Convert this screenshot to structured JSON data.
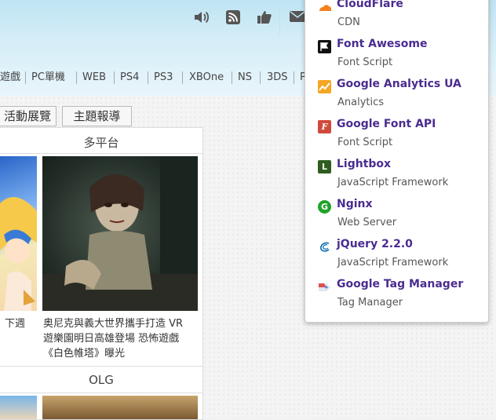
{
  "nav": {
    "items": [
      "遊戲",
      "PC單機",
      "WEB",
      "PS4",
      "PS3",
      "XBOne",
      "NS",
      "3DS",
      "P"
    ]
  },
  "tabs": [
    "活動展覽",
    "主題報導"
  ],
  "panel": {
    "section1_title": "多平台",
    "left_caption": "下週",
    "right_caption_lines": [
      "奥尼克與義大世界攜手打造 VR",
      "遊樂園明日高雄登場 恐怖遊戲",
      "《白色帷塔》曝光"
    ],
    "section2_title": "OLG"
  },
  "header_icons": [
    "volume-icon",
    "rss-icon",
    "thumbs-up-icon",
    "mail-icon"
  ],
  "popup": {
    "technologies": [
      {
        "name": "CloudFlare",
        "category": "CDN",
        "icon": "cloudflare-icon",
        "color": "#f38020"
      },
      {
        "name": "Font Awesome",
        "category": "Font Script",
        "icon": "font-awesome-icon",
        "color": "#111111"
      },
      {
        "name": "Google Analytics UA",
        "category": "Analytics",
        "icon": "google-analytics-icon",
        "color": "#f5a623"
      },
      {
        "name": "Google Font API",
        "category": "Font Script",
        "icon": "google-font-api-icon",
        "color": "#d04a3c"
      },
      {
        "name": "Lightbox",
        "category": "JavaScript Framework",
        "icon": "lightbox-icon",
        "color": "#2e7d32"
      },
      {
        "name": "Nginx",
        "category": "Web Server",
        "icon": "nginx-icon",
        "color": "#1fa32a"
      },
      {
        "name": "jQuery 2.2.0",
        "category": "JavaScript Framework",
        "icon": "jquery-icon",
        "color": "#0769ad"
      },
      {
        "name": "Google Tag Manager",
        "category": "Tag Manager",
        "icon": "google-tag-manager-icon",
        "color": "#4285f4"
      }
    ]
  },
  "colors": {
    "tech_name": "#4b2c8f",
    "header_gradient_top": "#bfe4f3"
  }
}
